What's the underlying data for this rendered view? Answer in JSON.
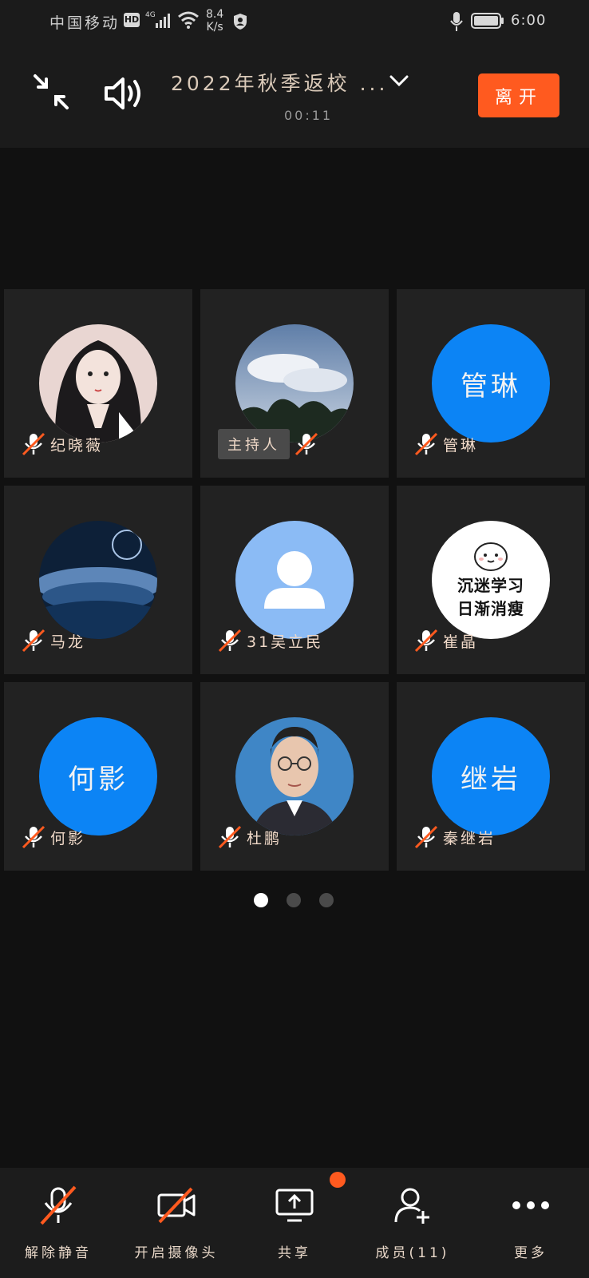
{
  "status_bar": {
    "carrier": "中国移动",
    "hd_badge": "HD",
    "network": "4G",
    "speed_value": "8.4",
    "speed_unit": "K/s",
    "time": "6:00"
  },
  "header": {
    "title": "2022年秋季返校 ...",
    "timer": "00:11",
    "leave_label": "离开"
  },
  "participants": [
    {
      "name": "纪晓薇",
      "avatar": "anime-girl-photo",
      "avatar_text": "",
      "mic": "muted"
    },
    {
      "name": "",
      "host_label": "主持人",
      "avatar": "sky-clouds-photo",
      "avatar_text": "",
      "mic": "muted"
    },
    {
      "name": "管琳",
      "avatar": "text",
      "avatar_text": "管琳",
      "mic": "muted"
    },
    {
      "name": "马龙",
      "avatar": "ocean-night-photo",
      "avatar_text": "",
      "mic": "muted"
    },
    {
      "name": "31吴立民",
      "avatar": "default-person",
      "avatar_text": "",
      "mic": "muted"
    },
    {
      "name": "崔晶",
      "avatar": "text-white",
      "avatar_text": "沉迷学习\n日渐消瘦",
      "avatar_line1": "沉迷学习",
      "avatar_line2": "日渐消瘦",
      "mic": "muted"
    },
    {
      "name": "何影",
      "avatar": "text",
      "avatar_text": "何影",
      "mic": "muted"
    },
    {
      "name": "杜鹏",
      "avatar": "man-portrait-photo",
      "avatar_text": "",
      "mic": "muted"
    },
    {
      "name": "秦继岩",
      "avatar": "text",
      "avatar_text": "继岩",
      "mic": "muted"
    }
  ],
  "pagination": {
    "pages": 3,
    "current": 1
  },
  "toolbar": {
    "unmute_label": "解除静音",
    "camera_label": "开启摄像头",
    "share_label": "共享",
    "members_label": "成员(11)",
    "more_label": "更多"
  },
  "colors": {
    "accent_orange": "#ff5a1f",
    "avatar_blue": "#0c84f5",
    "tile_bg": "#222222",
    "background": "#111111"
  }
}
